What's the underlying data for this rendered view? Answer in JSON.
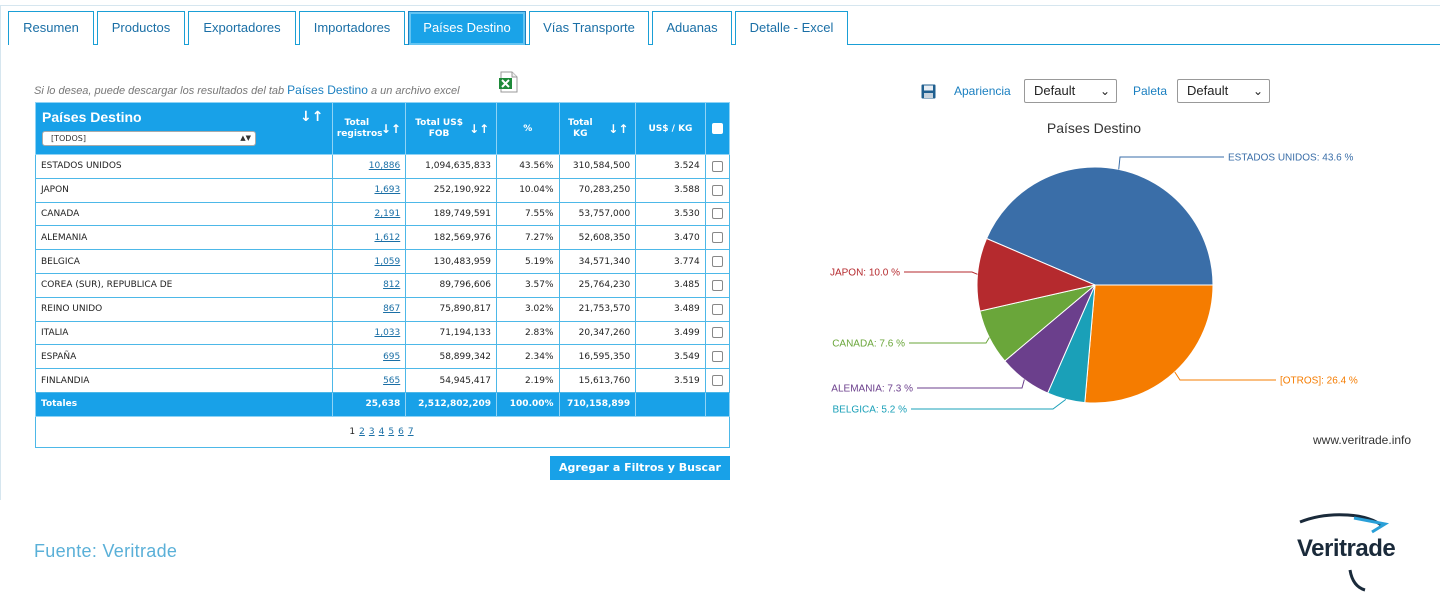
{
  "tabs": [
    {
      "label": "Resumen"
    },
    {
      "label": "Productos"
    },
    {
      "label": "Exportadores"
    },
    {
      "label": "Importadores"
    },
    {
      "label": "Países Destino",
      "active": true
    },
    {
      "label": "Vías Transporte"
    },
    {
      "label": "Aduanas"
    },
    {
      "label": "Detalle - Excel"
    }
  ],
  "download": {
    "prefix": "Si lo desea, puede descargar los resultados del tab",
    "tab_name": "Países Destino",
    "suffix": "a un archivo excel",
    "icon": "excel-icon"
  },
  "table": {
    "title": "Países Destino",
    "filter_value": "[TODOS]",
    "columns": [
      "Total registros",
      "Total US$ FOB",
      "%",
      "Total KG",
      "US$ / KG"
    ],
    "rows": [
      {
        "country": "ESTADOS UNIDOS",
        "count": "10,886",
        "fob": "1,094,635,833",
        "pct": "43.56%",
        "kg": "310,584,500",
        "usd_kg": "3.524"
      },
      {
        "country": "JAPON",
        "count": "1,693",
        "fob": "252,190,922",
        "pct": "10.04%",
        "kg": "70,283,250",
        "usd_kg": "3.588"
      },
      {
        "country": "CANADA",
        "count": "2,191",
        "fob": "189,749,591",
        "pct": "7.55%",
        "kg": "53,757,000",
        "usd_kg": "3.530"
      },
      {
        "country": "ALEMANIA",
        "count": "1,612",
        "fob": "182,569,976",
        "pct": "7.27%",
        "kg": "52,608,350",
        "usd_kg": "3.470"
      },
      {
        "country": "BELGICA",
        "count": "1,059",
        "fob": "130,483,959",
        "pct": "5.19%",
        "kg": "34,571,340",
        "usd_kg": "3.774"
      },
      {
        "country": "COREA (SUR), REPUBLICA DE",
        "count": "812",
        "fob": "89,796,606",
        "pct": "3.57%",
        "kg": "25,764,230",
        "usd_kg": "3.485"
      },
      {
        "country": "REINO UNIDO",
        "count": "867",
        "fob": "75,890,817",
        "pct": "3.02%",
        "kg": "21,753,570",
        "usd_kg": "3.489"
      },
      {
        "country": "ITALIA",
        "count": "1,033",
        "fob": "71,194,133",
        "pct": "2.83%",
        "kg": "20,347,260",
        "usd_kg": "3.499"
      },
      {
        "country": "ESPAÑA",
        "count": "695",
        "fob": "58,899,342",
        "pct": "2.34%",
        "kg": "16,595,350",
        "usd_kg": "3.549"
      },
      {
        "country": "FINLANDIA",
        "count": "565",
        "fob": "54,945,417",
        "pct": "2.19%",
        "kg": "15,613,760",
        "usd_kg": "3.519"
      }
    ],
    "totals": {
      "label": "Totales",
      "count": "25,638",
      "fob": "2,512,802,209",
      "pct": "100.00%",
      "kg": "710,158,899"
    },
    "pager": {
      "current": "1",
      "pages": [
        "2",
        "3",
        "4",
        "5",
        "6",
        "7"
      ]
    }
  },
  "add_button_label": "Agregar a Filtros y Buscar",
  "controls": {
    "appearance_label": "Apariencia",
    "appearance_value": "Default",
    "palette_label": "Paleta",
    "palette_value": "Default"
  },
  "chart_data": {
    "type": "pie",
    "title": "Países Destino",
    "slices": [
      {
        "label": "ESTADOS UNIDOS: 43.6 %",
        "value": 43.6,
        "color": "#3a6ea8"
      },
      {
        "label": "[OTROS]: 26.4 %",
        "value": 26.4,
        "color": "#f57c00"
      },
      {
        "label": "BELGICA: 5.2 %",
        "value": 5.2,
        "color": "#1aa0b8"
      },
      {
        "label": "ALEMANIA: 7.3 %",
        "value": 7.3,
        "color": "#6b3f8c"
      },
      {
        "label": "CANADA: 7.6 %",
        "value": 7.6,
        "color": "#6aa63a"
      },
      {
        "label": "JAPON: 10.0 %",
        "value": 10.0,
        "color": "#b52a2e"
      }
    ]
  },
  "chart_credit": "www.veritrade.info",
  "footer": {
    "source": "Fuente: Veritrade",
    "logo_text": "Veritrade"
  }
}
